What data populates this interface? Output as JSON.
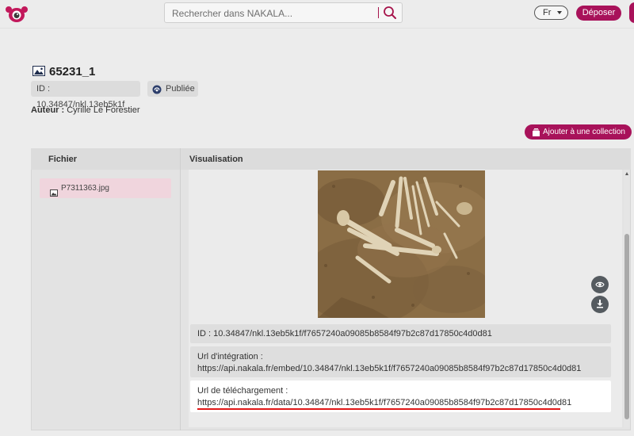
{
  "header": {
    "search_placeholder": "Rechercher dans NAKALA...",
    "language": "Fr",
    "deposit_label": "Déposer"
  },
  "record": {
    "title": "65231_1",
    "id_chip": "ID : 10.34847/nkl.13eb5k1f",
    "status": "Publiée",
    "author_label": "Auteur :",
    "author_name": "Cyrille Le Forestier",
    "add_collection_label": "Ajouter à une collection"
  },
  "files": {
    "column_header": "Fichier",
    "items": [
      {
        "name": "P7311363.jpg"
      }
    ]
  },
  "visualisation": {
    "column_header": "Visualisation",
    "id_line": "ID : 10.34847/nkl.13eb5k1f/f7657240a09085b8584f97b2c87d17850c4d0d81",
    "embed_label": "Url d'intégration :",
    "embed_url": "https://api.nakala.fr/embed/10.34847/nkl.13eb5k1f/f7657240a09085b8584f97b2c87d17850c4d0d81",
    "download_label": "Url de téléchargement :",
    "download_url": "https://api.nakala.fr/data/10.34847/nkl.13eb5k1f/f7657240a09085b8584f97b2c87d17850c4d0d81"
  },
  "icons": {
    "logo": "nakala-logo",
    "search": "search-icon",
    "image": "image-icon",
    "published": "published-icon",
    "collection": "collection-icon",
    "view": "eye-icon",
    "download": "download-icon"
  },
  "colors": {
    "brand": "#a8125a",
    "highlight": "#e01818",
    "file_selected": "#f0d5dd"
  }
}
